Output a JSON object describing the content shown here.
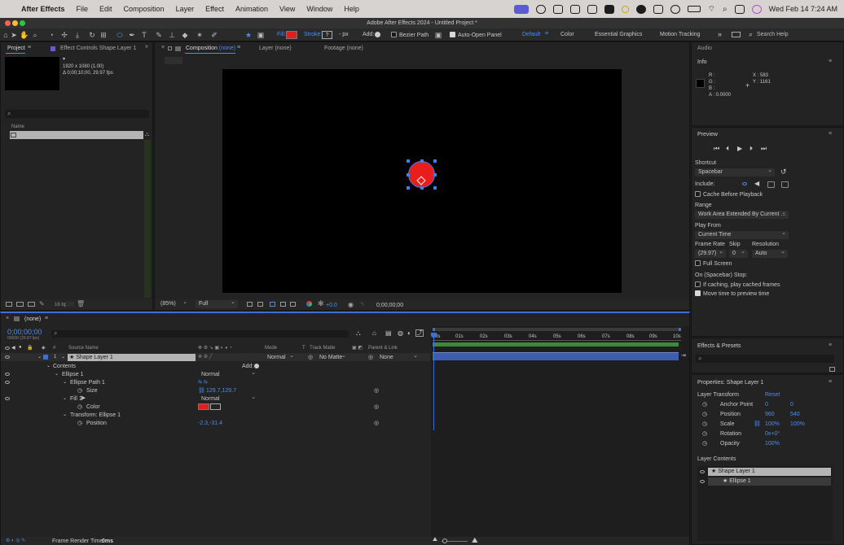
{
  "menubar": {
    "apple": "",
    "app": "After Effects",
    "items": [
      "File",
      "Edit",
      "Composition",
      "Layer",
      "Effect",
      "Animation",
      "View",
      "Window",
      "Help"
    ],
    "clock": "Wed Feb 14  7:24 AM",
    "status_icons": [
      "screen-mirroring-icon",
      "cloud-icon",
      "dropbox-icon",
      "camera-icon",
      "mail-icon",
      "ai-icon",
      "s-icon",
      "chatgpt-icon",
      "grid-icon",
      "history-icon",
      "battery-icon",
      "wifi-icon",
      "search-icon",
      "control-center-icon",
      "siri-icon"
    ]
  },
  "window": {
    "title": "Adobe After Effects 2024 - Untitled Project *"
  },
  "toolbar": {
    "fill_label": "Fill:",
    "stroke_label": "Stroke:",
    "stroke_value": "?",
    "px_label": "- px",
    "add_label": "Add:",
    "bezier_label": "Bezier Path",
    "auto_open_label": "Auto-Open Panel",
    "workspaces": [
      "Default",
      "Color",
      "Essential Graphics",
      "Motion Tracking"
    ],
    "search_placeholder": "Search Help",
    "fill_color": "#e02020"
  },
  "project": {
    "tab": "Project",
    "effect_tab": "Effect Controls Shape Layer 1",
    "info_line1": "1920 x 1080 (1.00)",
    "info_line2": "Δ 0;00;10;00, 29.97 fps",
    "search_placeholder": "",
    "col_name": "Name",
    "bpc": "16 bpc"
  },
  "composition": {
    "tab": "Composition",
    "tab_sub": "(none)",
    "layer_tab": "Layer",
    "layer_sub": "(none)",
    "footage_tab": "Footage",
    "footage_sub": "(none)",
    "zoom": "(85%)",
    "resolution": "Full",
    "exposure": "+0.0",
    "timecode": "0;00;00;00"
  },
  "info": {
    "title": "Info",
    "r": "R :",
    "g": "G :",
    "b": "B :",
    "a": "A :  0.0000",
    "x": "X : 583",
    "y": "Y : 1161"
  },
  "preview": {
    "title": "Preview",
    "shortcut_label": "Shortcut",
    "shortcut": "Spacebar",
    "include_label": "Include:",
    "cache_label": "Cache Before Playback",
    "range_label": "Range",
    "range": "Work Area Extended By Current ...",
    "play_from_label": "Play From",
    "play_from": "Current Time",
    "frame_rate_label": "Frame Rate",
    "skip_label": "Skip",
    "resolution_label": "Resolution",
    "frame_rate": "(29.97)",
    "skip": "0",
    "resolution": "Auto",
    "full_screen_label": "Full Screen",
    "on_stop_label": "On (Spacebar) Stop:",
    "if_caching_label": "If caching, play cached frames",
    "move_time_label": "Move time to preview time"
  },
  "effects": {
    "title": "Effects & Presets",
    "search_placeholder": ""
  },
  "properties": {
    "title": "Properties: Shape Layer 1",
    "layer_transform": "Layer Transform",
    "reset": "Reset",
    "rows": [
      {
        "label": "Anchor Point",
        "v1": "0",
        "v2": "0"
      },
      {
        "label": "Position",
        "v1": "960",
        "v2": "540"
      },
      {
        "label": "Scale",
        "v1": "100%",
        "v2": "100%"
      },
      {
        "label": "Rotation",
        "v1": "0x+0°",
        "v2": ""
      },
      {
        "label": "Opacity",
        "v1": "100%",
        "v2": ""
      }
    ],
    "layer_contents": "Layer Contents",
    "shape_layer": "Shape Layer 1",
    "ellipse": "Ellipse 1"
  },
  "timeline": {
    "tab": "(none)",
    "timecode": "0;00;00;00",
    "timecode_sub": "00000 (29.97 fps)",
    "cols": {
      "num": "#",
      "source": "Source Name",
      "mode": "Mode",
      "t": "T",
      "trkmat": "Track Matte",
      "parent": "Parent & Link"
    },
    "layer": {
      "num": "1",
      "name": "Shape Layer 1",
      "mode": "Normal",
      "matte": "No Matte",
      "parent": "None"
    },
    "contents": "Contents",
    "add": "Add:",
    "ellipse1": "Ellipse 1",
    "ellipse1_mode": "Normal",
    "ellipse_path": "Ellipse Path 1",
    "size": "Size",
    "size_val": "129.7,129.7",
    "fill": "Fill 1",
    "fill_mode": "Normal",
    "color": "Color",
    "transform": "Transform: Ellipse 1",
    "position": "Position",
    "position_val": "-2.3,-31.4",
    "ruler": [
      "0s",
      "01s",
      "02s",
      "03s",
      "04s",
      "05s",
      "06s",
      "07s",
      "08s",
      "09s",
      "10s"
    ],
    "frame_render": "Frame Render Time",
    "frame_render_val": "0ms"
  }
}
